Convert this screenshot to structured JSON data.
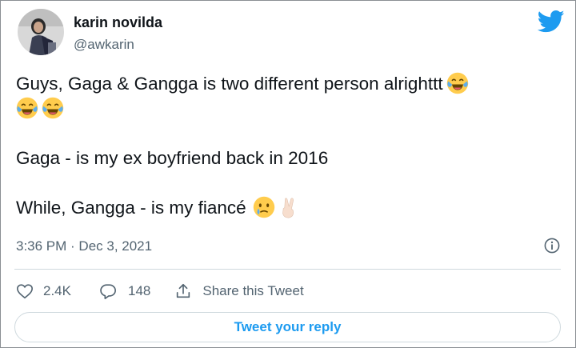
{
  "user": {
    "display_name": "karin novilda",
    "handle": "@awkarin"
  },
  "tweet": {
    "line1": "Guys, Gaga & Gangga is two different person alrighttt",
    "line3": "Gaga - is my ex boyfriend back in 2016",
    "line4": "While, Gangga - is my fiancé",
    "timestamp": "3:36 PM · Dec 3, 2021"
  },
  "actions": {
    "likes": "2.4K",
    "replies": "148",
    "share_label": "Share this Tweet"
  },
  "reply_button_label": "Tweet your reply",
  "icons": [
    "twitter-logo",
    "joy-emoji",
    "crying-face-emoji",
    "victory-hand-emoji",
    "info-icon",
    "heart-icon",
    "reply-icon",
    "share-icon"
  ],
  "colors": {
    "twitter_blue": "#1d9bf0",
    "secondary_text": "#536471",
    "divider": "#cfd9de"
  }
}
